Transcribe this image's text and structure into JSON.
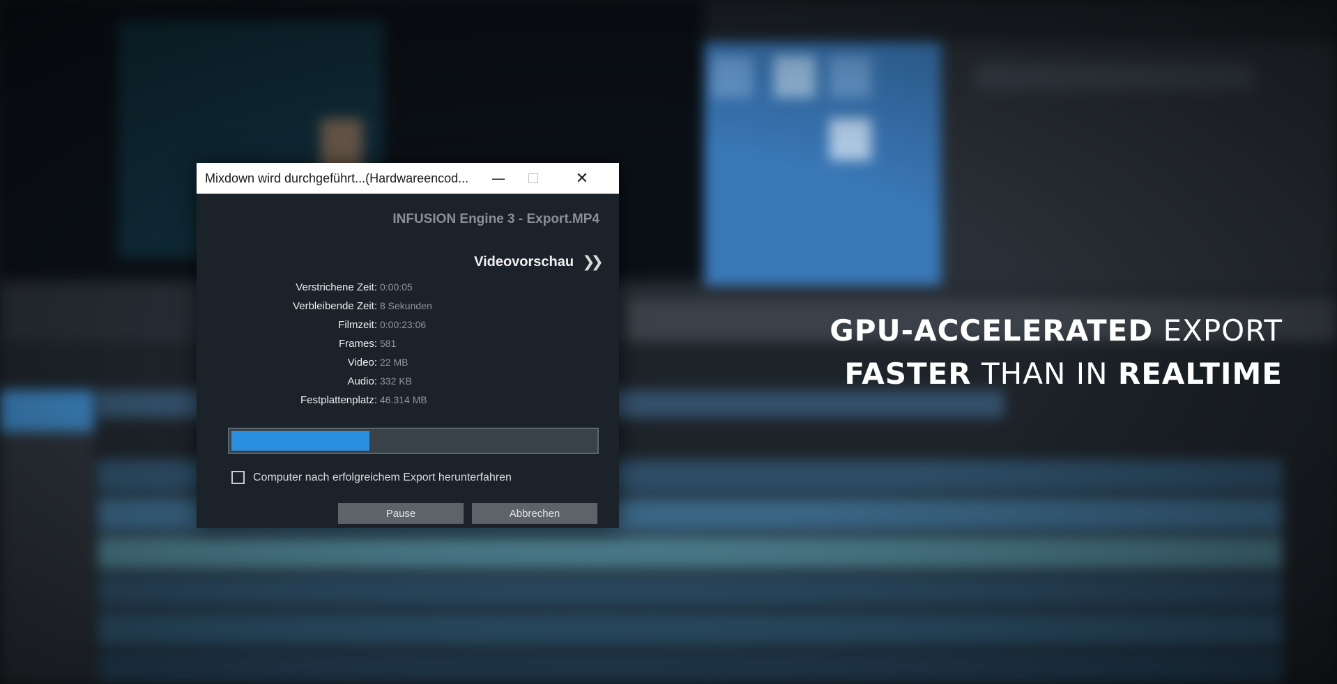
{
  "dialog": {
    "title": "Mixdown wird durchgeführt...(Hardwareencod...",
    "engine_title": "INFUSION Engine 3 - Export.MP4",
    "preview_label": "Videovorschau",
    "preview_icon": "double-chevron-right-icon",
    "stats": [
      {
        "label": "Verstrichene Zeit:",
        "value": "0:00:05"
      },
      {
        "label": "Verbleibende Zeit:",
        "value": "8 Sekunden"
      },
      {
        "label": "Filmzeit:",
        "value": "0:00:23:06"
      },
      {
        "label": "Frames:",
        "value": "581"
      },
      {
        "label": "Video:",
        "value": "22 MB"
      },
      {
        "label": "Audio:",
        "value": "332 KB"
      },
      {
        "label": "Festplattenplatz:",
        "value": "46.314 MB"
      }
    ],
    "progress_fraction": 0.38,
    "progress_color": "#2b8fe0",
    "shutdown_checkbox": {
      "label": "Computer nach erfolgreichem Export herunterfahren",
      "checked": false
    },
    "pause_label": "Pause",
    "cancel_label": "Abbrechen",
    "window_controls": [
      "minimize-icon",
      "maximize-icon",
      "close-icon"
    ]
  },
  "tagline": {
    "line1_bold": "GPU-ACCELERATED",
    "line1_light": " EXPORT",
    "line2_bold_a": "FASTER",
    "line2_light": " THAN IN ",
    "line2_bold_b": "REALTIME"
  }
}
